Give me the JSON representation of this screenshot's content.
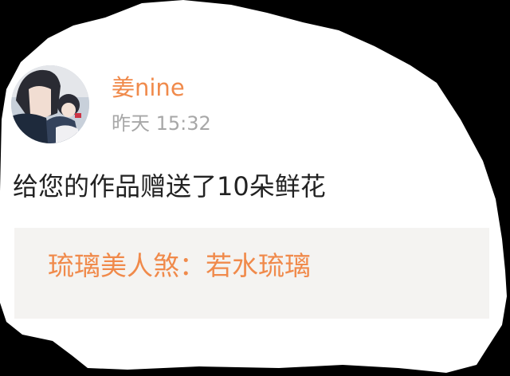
{
  "post": {
    "user": {
      "name": "姜nine",
      "avatar_icon": "anime-avatar"
    },
    "time": "昨天 15:32",
    "message": "给您的作品赠送了10朵鲜花",
    "work_ref": "琉璃美人煞：若水琉璃"
  },
  "colors": {
    "accent": "#f08a4b",
    "muted": "#a7a7a7",
    "text": "#222222",
    "quote_bg": "#f4f3f1",
    "background": "#000000",
    "card": "#ffffff"
  }
}
